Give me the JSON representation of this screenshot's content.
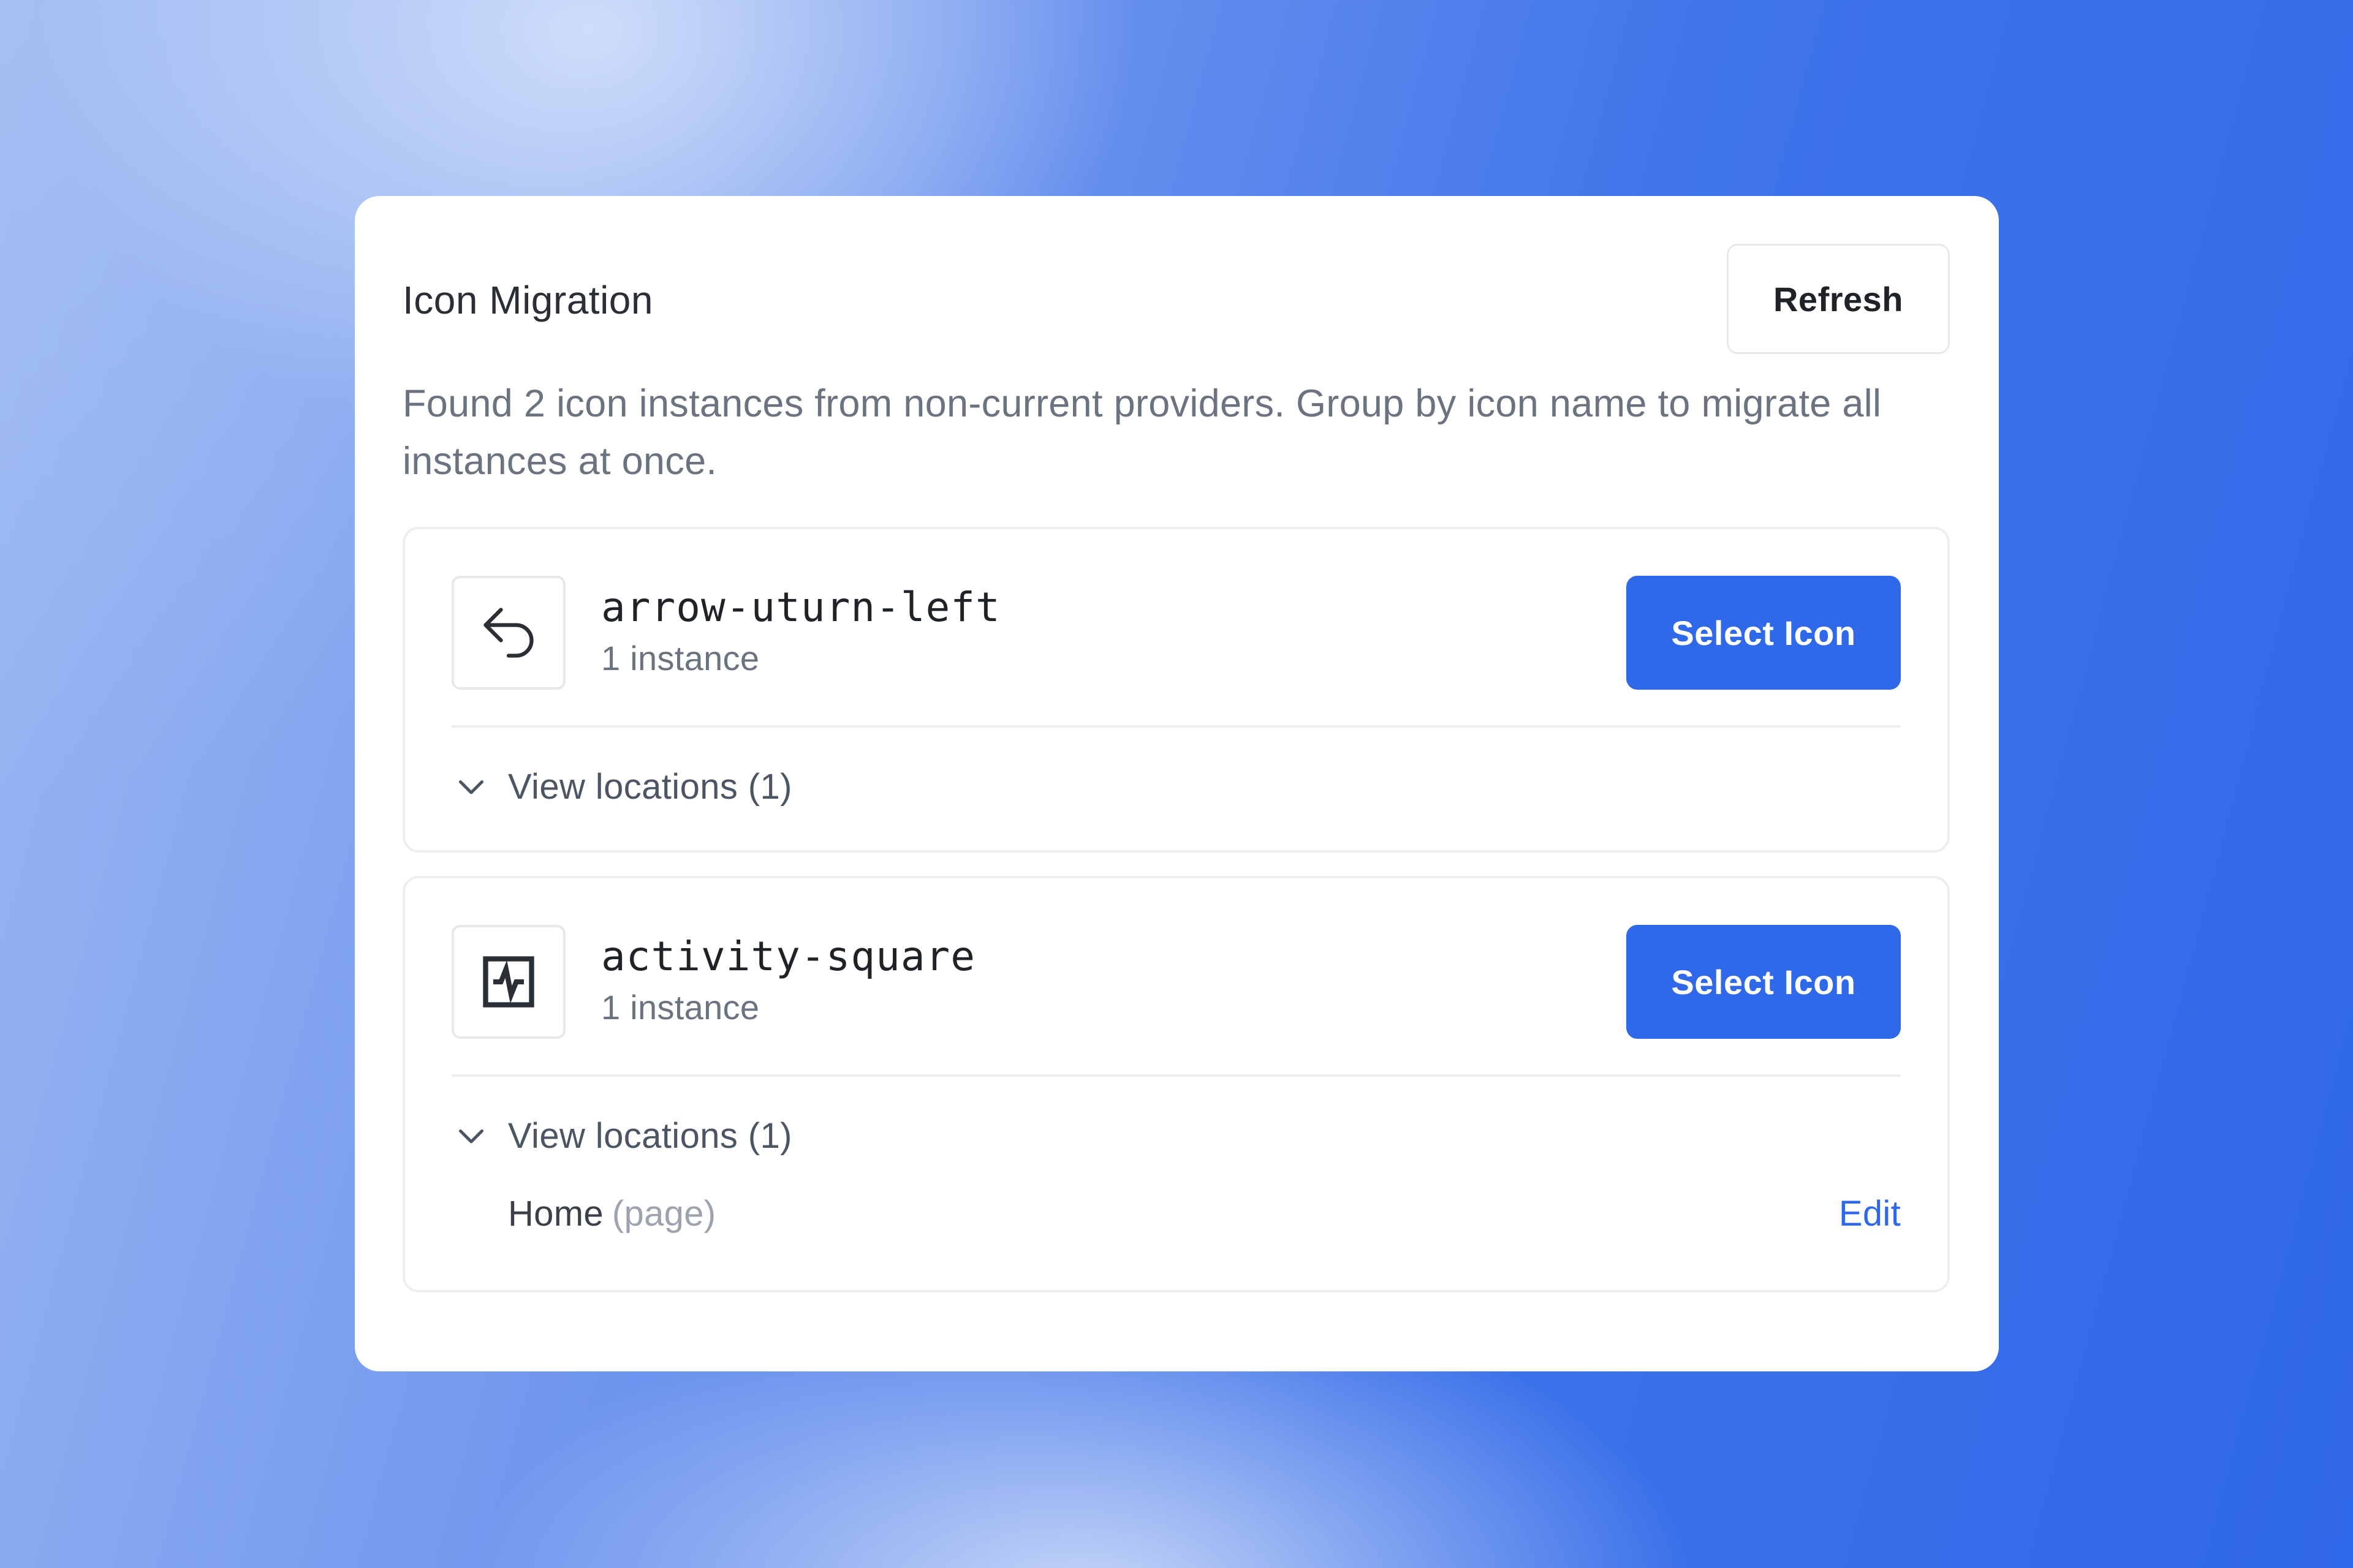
{
  "panel": {
    "title": "Icon Migration",
    "refresh_label": "Refresh",
    "description": "Found 2 icon instances from non-current providers. Group by icon name to migrate all instances at once."
  },
  "groups": [
    {
      "icon": "arrow-uturn-left-icon",
      "name": "arrow-uturn-left",
      "count": "1 instance",
      "select_label": "Select Icon",
      "locations_label": "View locations (1)",
      "expanded": false,
      "locations": []
    },
    {
      "icon": "activity-square-icon",
      "name": "activity-square",
      "count": "1 instance",
      "select_label": "Select Icon",
      "locations_label": "View locations (1)",
      "expanded": true,
      "locations": [
        {
          "name": "Home",
          "type": "(page)",
          "action": "Edit"
        }
      ]
    }
  ],
  "colors": {
    "accent": "#2f68e8",
    "text_primary": "#1f2328",
    "text_muted": "#6b7280",
    "border": "#eceef1"
  }
}
